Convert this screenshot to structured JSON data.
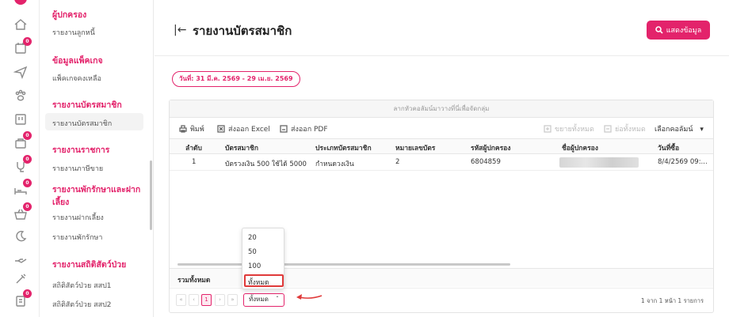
{
  "sidebar": {
    "sections": [
      {
        "heading": "ผู้ปกครอง",
        "items": [
          "รายงานลูกหนี้"
        ]
      },
      {
        "heading": "ข้อมูลแพ็คเกจ",
        "items": [
          "แพ็คเกจคงเหลือ"
        ]
      },
      {
        "heading": "รายงานบัตรสมาชิก",
        "items": [
          "รายงานบัตรสมาชิก"
        ]
      },
      {
        "heading": "รายงานราชการ",
        "items": [
          "รายงานภาษีขาย"
        ]
      },
      {
        "heading": "รายงานพักรักษาและฝากเลี้ยง",
        "items": [
          "รายงานฝากเลี้ยง",
          "รายงานพักรักษา"
        ]
      },
      {
        "heading": "รายงานสถิติสัตว์ป่วย",
        "items": [
          "สถิติสัตว์ป่วย สสป1",
          "สถิติสัตว์ป่วย สสป2"
        ]
      }
    ]
  },
  "rail": {
    "badge": "0"
  },
  "header": {
    "title": "รายงานบัตรสมาชิก",
    "show_button": "แสดงข้อมูล"
  },
  "filter": {
    "date_range": "วันที่: 31 มี.ค. 2569 - 29 เม.ย. 2569"
  },
  "grid": {
    "group_hint": "ลากหัวคอลัมน์มาวางที่นี่เพื่อจัดกลุ่ม",
    "toolbar": {
      "print": "พิมพ์",
      "export_excel": "ส่งออก Excel",
      "export_pdf": "ส่งออก PDF",
      "expand_all": "ขยายทั้งหมด",
      "collapse_all": "ย่อทั้งหมด",
      "choose_columns": "เลือกคอลัมน์"
    },
    "columns": [
      "ลำดับ",
      "บัตรสมาชิก",
      "ประเภทบัตรสมาชิก",
      "หมายเลขบัตร",
      "รหัสผู้ปกครอง",
      "ชื่อผู้ปกครอง",
      "วันที่ซื้อ"
    ],
    "rows": [
      {
        "no": "1",
        "card": "บัตรวงเงิน 500 ใช้ได้ 5000",
        "type": "กำหนดวงเงิน",
        "card_no": "2",
        "owner_code": "6804859",
        "date": "8/4/2569 09:..."
      }
    ],
    "total_label": "รวมทั้งหมด",
    "pager": {
      "first": "«",
      "prev": "‹",
      "current": "1",
      "next": "›",
      "last": "»",
      "page_size": "ทั้งหมด",
      "info": "1 จาก 1 หน้า 1 รายการ"
    },
    "page_size_options": [
      "20",
      "50",
      "100",
      "ทั้งหมด"
    ]
  },
  "colors": {
    "accent": "#e3236b",
    "highlight": "#e03a3a"
  }
}
